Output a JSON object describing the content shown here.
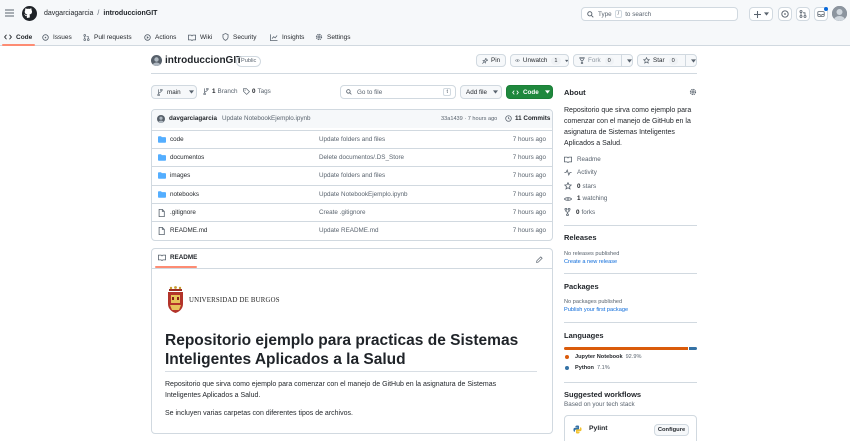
{
  "header": {
    "owner": "davgarciagarcia",
    "separator": "/",
    "repo": "introduccionGIT",
    "search_prefix": "Type",
    "search_key": "/",
    "search_suffix": "to search"
  },
  "tabs": [
    {
      "label": "Code",
      "active": true
    },
    {
      "label": "Issues"
    },
    {
      "label": "Pull requests"
    },
    {
      "label": "Actions"
    },
    {
      "label": "Wiki"
    },
    {
      "label": "Security"
    },
    {
      "label": "Insights"
    },
    {
      "label": "Settings"
    }
  ],
  "repo": {
    "name": "introduccionGIT",
    "visibility": "Public",
    "pin_label": "Pin",
    "unwatch_label": "Unwatch",
    "watch_count": "1",
    "fork_label": "Fork",
    "fork_count": "0",
    "star_label": "Star",
    "star_count": "0"
  },
  "toolbar": {
    "branch": "main",
    "branches_count": "1",
    "branches_label": "Branch",
    "tags_count": "0",
    "tags_label": "Tags",
    "goto_placeholder": "Go to file",
    "goto_key": "t",
    "add_file_label": "Add file",
    "code_label": "Code"
  },
  "commit": {
    "author": "davgarciagarcia",
    "message": "Update NotebookEjemplo.ipynb",
    "hash_time": "33a1439 · 7 hours ago",
    "commits_label": "11 Commits"
  },
  "files": [
    {
      "name": "code",
      "type": "folder",
      "message": "Update folders and files",
      "time": "7 hours ago"
    },
    {
      "name": "documentos",
      "type": "folder",
      "message": "Delete documentos/.DS_Store",
      "time": "7 hours ago"
    },
    {
      "name": "images",
      "type": "folder",
      "message": "Update folders and files",
      "time": "7 hours ago"
    },
    {
      "name": "notebooks",
      "type": "folder",
      "message": "Update NotebookEjemplo.ipynb",
      "time": "7 hours ago"
    },
    {
      "name": ".gitignore",
      "type": "file",
      "message": "Create .gitignore",
      "time": "7 hours ago"
    },
    {
      "name": "README.md",
      "type": "file",
      "message": "Update README.md",
      "time": "7 hours ago"
    }
  ],
  "readme": {
    "tab_label": "README",
    "logo_text": "UNIVERSIDAD DE BURGOS",
    "title": "Repositorio ejemplo para practicas de Sistemas Inteligentes Aplicados a la Salud",
    "paragraph1": "Repositorio que sirva como ejemplo para comenzar con el manejo de GitHub en la asignatura de Sistemas Inteligentes Aplicados a Salud.",
    "paragraph2": "Se incluyen varias carpetas con diferentes tipos de archivos."
  },
  "about": {
    "heading": "About",
    "description": "Repositorio que sirva como ejemplo para comenzar con el manejo de GitHub en la asignatura de Sistemas Inteligentes Aplicados a Salud.",
    "readme": "Readme",
    "activity": "Activity",
    "stars_count": "0",
    "stars_label": "stars",
    "watching_count": "1",
    "watching_label": "watching",
    "forks_count": "0",
    "forks_label": "forks"
  },
  "releases": {
    "heading": "Releases",
    "none_text": "No releases published",
    "link": "Create a new release"
  },
  "packages": {
    "heading": "Packages",
    "none_text": "No packages published",
    "link": "Publish your first package"
  },
  "languages": {
    "heading": "Languages",
    "items": [
      {
        "name": "Jupyter Notebook",
        "percent": "92.9%",
        "value": 92.9,
        "color": "#DA5B0B"
      },
      {
        "name": "Python",
        "percent": "7.1%",
        "value": 7.1,
        "color": "#3572A5"
      }
    ]
  },
  "workflows": {
    "heading": "Suggested workflows",
    "subtitle": "Based on your tech stack",
    "item": "Pylint",
    "configure": "Configure"
  },
  "colors": {
    "code_button": "#1f883d",
    "active_tab_underline": "#fd8c73",
    "link": "#0969da"
  }
}
